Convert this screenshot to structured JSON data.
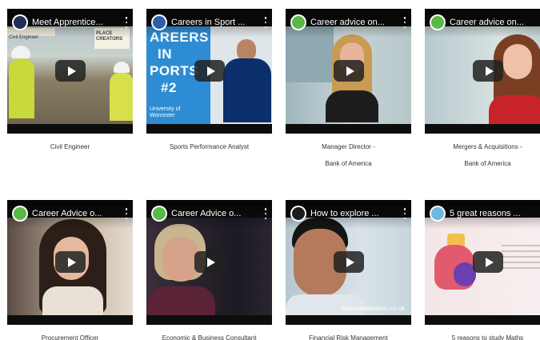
{
  "videos": [
    {
      "title": "Meet Apprentice...",
      "caption_lines": [
        "Civil Engineer"
      ],
      "channel_color": "#1f2f5a",
      "thumb_subtitle": "Civil Engineer",
      "thumb_logo": "PLACE CREATORS"
    },
    {
      "title": "Careers in Sport ...",
      "caption_lines": [
        "Sports Performance Analyst"
      ],
      "channel_color": "#2d5fa8",
      "thumb_lines": [
        "AREERS",
        "IN",
        "PORTS",
        "#2"
      ],
      "thumb_org": "University of Worcester"
    },
    {
      "title": "Career advice on...",
      "caption_lines": [
        "Manager Director  -",
        "Bank of America"
      ],
      "channel_color": "#58b947"
    },
    {
      "title": "Career advice on...",
      "caption_lines": [
        "Mergers & Acquisitions  -",
        "Bank of America"
      ],
      "channel_color": "#58b947"
    },
    {
      "title": "Career Advice o...",
      "caption_lines": [
        "Procurement Officer"
      ],
      "channel_color": "#58b947"
    },
    {
      "title": "Career Advice o...",
      "caption_lines": [
        "Economic & Business Consultant"
      ],
      "channel_color": "#58b947"
    },
    {
      "title": "How to explore ...",
      "caption_lines": [
        "Financial Risk Management"
      ],
      "channel_color": "#1c1c1c",
      "thumb_watermark": "www.careersbox.co.uk"
    },
    {
      "title": "5 great reasons ...",
      "caption_lines": [
        "5 reasons to study Maths"
      ],
      "channel_color": "#6fb7de"
    }
  ],
  "icons": {
    "play": "play-icon",
    "menu": "kebab-menu-icon",
    "channel": "channel-avatar-icon"
  }
}
